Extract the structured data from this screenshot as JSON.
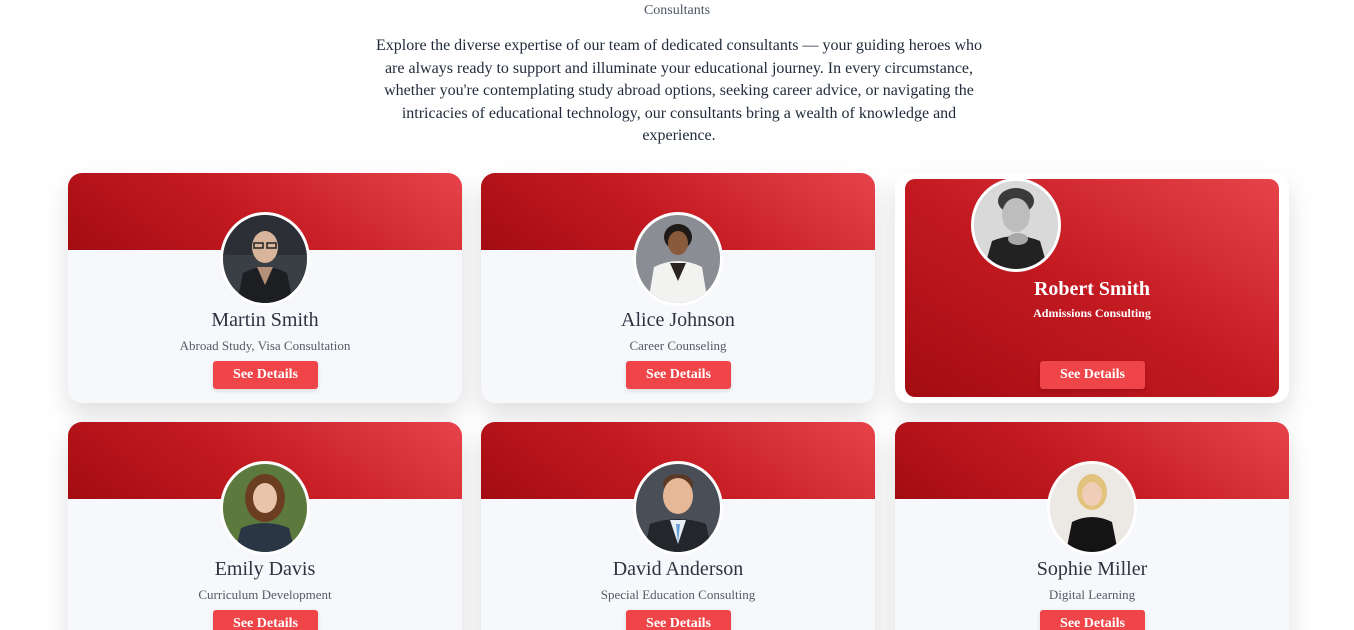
{
  "section": {
    "label": "Consultants",
    "intro": "Explore the diverse expertise of our team of dedicated consultants — your guiding heroes who are always ready to support and illuminate your educational journey. In every circumstance, whether you're contemplating study abroad options, seeking career advice, or navigating the intricacies of educational technology, our consultants bring a wealth of knowledge and experience."
  },
  "colors": {
    "accent": "#ef4548",
    "band_dark": "#a30c12",
    "band_light": "#e8434a",
    "card_bg": "#f7f8fb"
  },
  "consultants": [
    {
      "name": "Martin Smith",
      "role": "Abroad Study, Visa Consultation",
      "button": "See Details",
      "photo": "man-glasses-photo"
    },
    {
      "name": "Alice Johnson",
      "role": "Career Counseling",
      "button": "See Details",
      "photo": "woman-white-blazer-photo"
    },
    {
      "name": "Robert Smith",
      "role": "Admissions Consulting",
      "button": "See Details",
      "photo": "man-bw-photo"
    },
    {
      "name": "Emily Davis",
      "role": "Curriculum Development",
      "button": "See Details",
      "photo": "woman-outdoor-photo"
    },
    {
      "name": "David Anderson",
      "role": "Special Education Consulting",
      "button": "See Details",
      "photo": "man-suit-photo"
    },
    {
      "name": "Sophie Miller",
      "role": "Digital Learning",
      "button": "See Details",
      "photo": "woman-blonde-photo"
    }
  ]
}
